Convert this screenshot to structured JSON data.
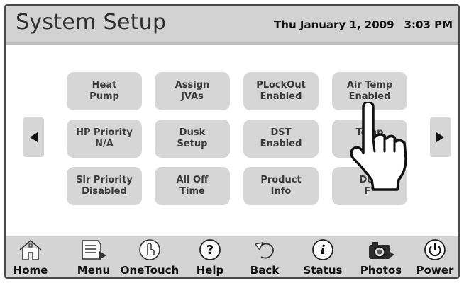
{
  "header": {
    "title": "System Setup",
    "date": "Thu January 1, 2009",
    "time": "3:03 PM"
  },
  "grid": {
    "buttons": [
      {
        "label": "Heat\nPump"
      },
      {
        "label": "Assign\nJVAs"
      },
      {
        "label": "PLockOut\nEnabled"
      },
      {
        "label": "Air Temp\nEnabled"
      },
      {
        "label": "HP Priority\nN/A"
      },
      {
        "label": "Dusk\nSetup"
      },
      {
        "label": "DST\nEnabled"
      },
      {
        "label": "Temp\nCal"
      },
      {
        "label": "Slr Priority\nDisabled"
      },
      {
        "label": "All Off\nTime"
      },
      {
        "label": "Product\nInfo"
      },
      {
        "label": "Deg\nF°"
      }
    ]
  },
  "nav": {
    "prev_icon": "left-arrow-icon",
    "next_icon": "right-arrow-icon"
  },
  "footer": {
    "items": [
      {
        "label": "Home",
        "icon": "home-icon"
      },
      {
        "label": "Menu",
        "icon": "menu-icon"
      },
      {
        "label": "OneTouch",
        "icon": "onetouch-icon"
      },
      {
        "label": "Help",
        "icon": "help-icon"
      },
      {
        "label": "Back",
        "icon": "back-icon"
      },
      {
        "label": "Status",
        "icon": "status-icon"
      },
      {
        "label": "Photos",
        "icon": "camera-icon"
      },
      {
        "label": "Power",
        "icon": "power-icon"
      }
    ]
  },
  "overlay": {
    "icon": "pointing-hand-icon"
  },
  "colors": {
    "header_bg": "#d2d2d2",
    "button_bg": "#d6d6d6",
    "footer_bg": "#d4d4d4",
    "frame_border": "#4a4a4a"
  }
}
